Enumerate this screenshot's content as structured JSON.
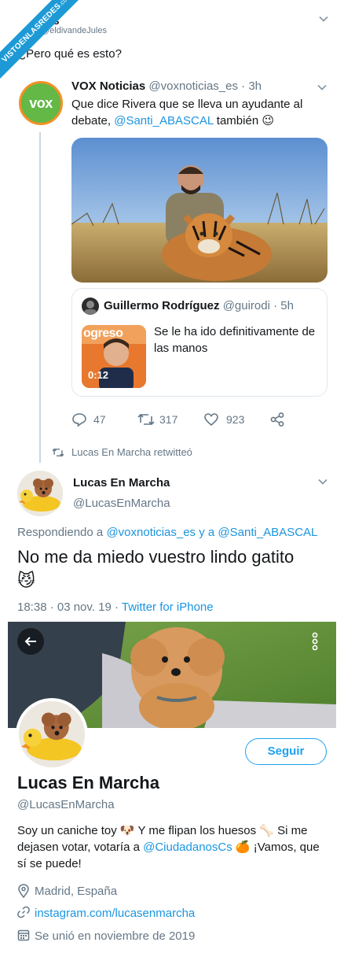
{
  "watermark": {
    "text": "VISTOENLASREDES",
    "sub": ".com"
  },
  "main_tweet": {
    "name_partial": "es",
    "handle_partial": "@eldivandeJules",
    "text": "¿Pero qué es esto?"
  },
  "quoted_tweet": {
    "author": "VOX Noticias",
    "handle": "@voxnoticias_es",
    "time": "· 3h",
    "logo_text": "vox",
    "text_before": "Que dice Rivera que se lleva un ayudante al debate, ",
    "mention": "@Santi_ABASCAL",
    "text_after": " también 😉",
    "nested": {
      "author": "Guillermo Rodríguez",
      "handle": "@guirodi",
      "time": "· 5h",
      "text": "Se le ha ido definitivamente de las manos",
      "video_duration": "0:12",
      "thumb_sign": "ogreso"
    },
    "actions": {
      "replies": "47",
      "retweets": "317",
      "likes": "923"
    }
  },
  "retweet_note": "Lucas En Marcha retwitteó",
  "reply_tweet": {
    "author": "Lucas En Marcha",
    "handle": "@LucasEnMarcha",
    "replying_label": "Respondiendo a ",
    "replying_to1": "@voxnoticias_es",
    "replying_joiner": " y a ",
    "replying_to2": "@Santi_ABASCAL",
    "text": "No me da miedo vuestro lindo gatito",
    "emoji": "😼",
    "date": "18:38 · 03 nov. 19 · ",
    "source": "Twitter for iPhone"
  },
  "profile": {
    "name": "Lucas En Marcha",
    "handle": "@LucasEnMarcha",
    "follow_label": "Seguir",
    "bio_part1": "Soy un caniche toy 🐶 Y me flipan los huesos 🦴 Si me dejasen votar, votaría a ",
    "bio_mention": "@CiudadanosCs",
    "bio_part2": " 🍊 ¡Vamos, que sí se puede!",
    "location": "Madrid, España",
    "website": "instagram.com/lucasenmarcha",
    "joined": "Se unió en noviembre de 2019"
  },
  "colors": {
    "twitter_blue": "#1da1f2",
    "link": "#1b95e0",
    "muted": "#657786",
    "vox_green": "#63b846"
  }
}
